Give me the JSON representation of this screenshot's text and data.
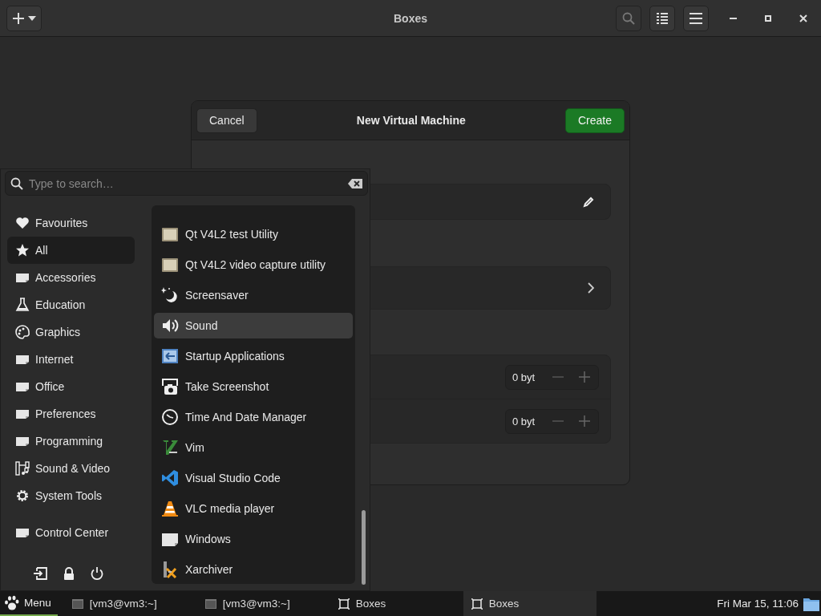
{
  "window": {
    "title": "Boxes"
  },
  "dialog": {
    "title": "New Virtual Machine",
    "cancel": "Cancel",
    "create": "Create",
    "spin_values": [
      "0 byt",
      "0 byt"
    ]
  },
  "menu": {
    "search": {
      "placeholder": "Type to search…"
    },
    "categories": [
      {
        "label": "Favourites",
        "kind": "heart",
        "selected": false
      },
      {
        "label": "All",
        "kind": "star",
        "selected": true
      },
      {
        "label": "Accessories",
        "kind": "folder",
        "selected": false
      },
      {
        "label": "Education",
        "kind": "flask",
        "selected": false
      },
      {
        "label": "Graphics",
        "kind": "palette",
        "selected": false
      },
      {
        "label": "Internet",
        "kind": "folder",
        "selected": false
      },
      {
        "label": "Office",
        "kind": "folder",
        "selected": false
      },
      {
        "label": "Preferences",
        "kind": "folder",
        "selected": false
      },
      {
        "label": "Programming",
        "kind": "folder",
        "selected": false
      },
      {
        "label": "Sound & Video",
        "kind": "film",
        "selected": false
      },
      {
        "label": "System Tools",
        "kind": "gear",
        "selected": false
      }
    ],
    "control_center": {
      "label": "Control Center",
      "kind": "folder"
    },
    "apps": [
      {
        "label": "Qt V4L2 test Utility",
        "kind": "qt",
        "selected": false
      },
      {
        "label": "Qt V4L2 video capture utility",
        "kind": "qt",
        "selected": false
      },
      {
        "label": "Screensaver",
        "kind": "moon",
        "selected": false
      },
      {
        "label": "Sound",
        "kind": "speaker",
        "selected": true
      },
      {
        "label": "Startup Applications",
        "kind": "startup",
        "selected": false
      },
      {
        "label": "Take Screenshot",
        "kind": "camera",
        "selected": false
      },
      {
        "label": "Time And Date Manager",
        "kind": "clock",
        "selected": false
      },
      {
        "label": "Vim",
        "kind": "vim",
        "selected": false
      },
      {
        "label": "Visual Studio Code",
        "kind": "code",
        "selected": false
      },
      {
        "label": "VLC media player",
        "kind": "cone",
        "selected": false
      },
      {
        "label": "Windows",
        "kind": "card",
        "selected": false
      },
      {
        "label": "Xarchiver",
        "kind": "archive",
        "selected": false
      }
    ]
  },
  "taskbar": {
    "menu": "Menu",
    "tasks": [
      {
        "label": "[vm3@vm3:~]",
        "kind": "terminal",
        "selected": false
      },
      {
        "label": "[vm3@vm3:~]",
        "kind": "terminal",
        "selected": false
      },
      {
        "label": "Boxes",
        "kind": "boxes",
        "selected": false
      },
      {
        "label": "Boxes",
        "kind": "boxes",
        "selected": true
      }
    ],
    "clock": "Fri Mar 15, 11:06"
  }
}
